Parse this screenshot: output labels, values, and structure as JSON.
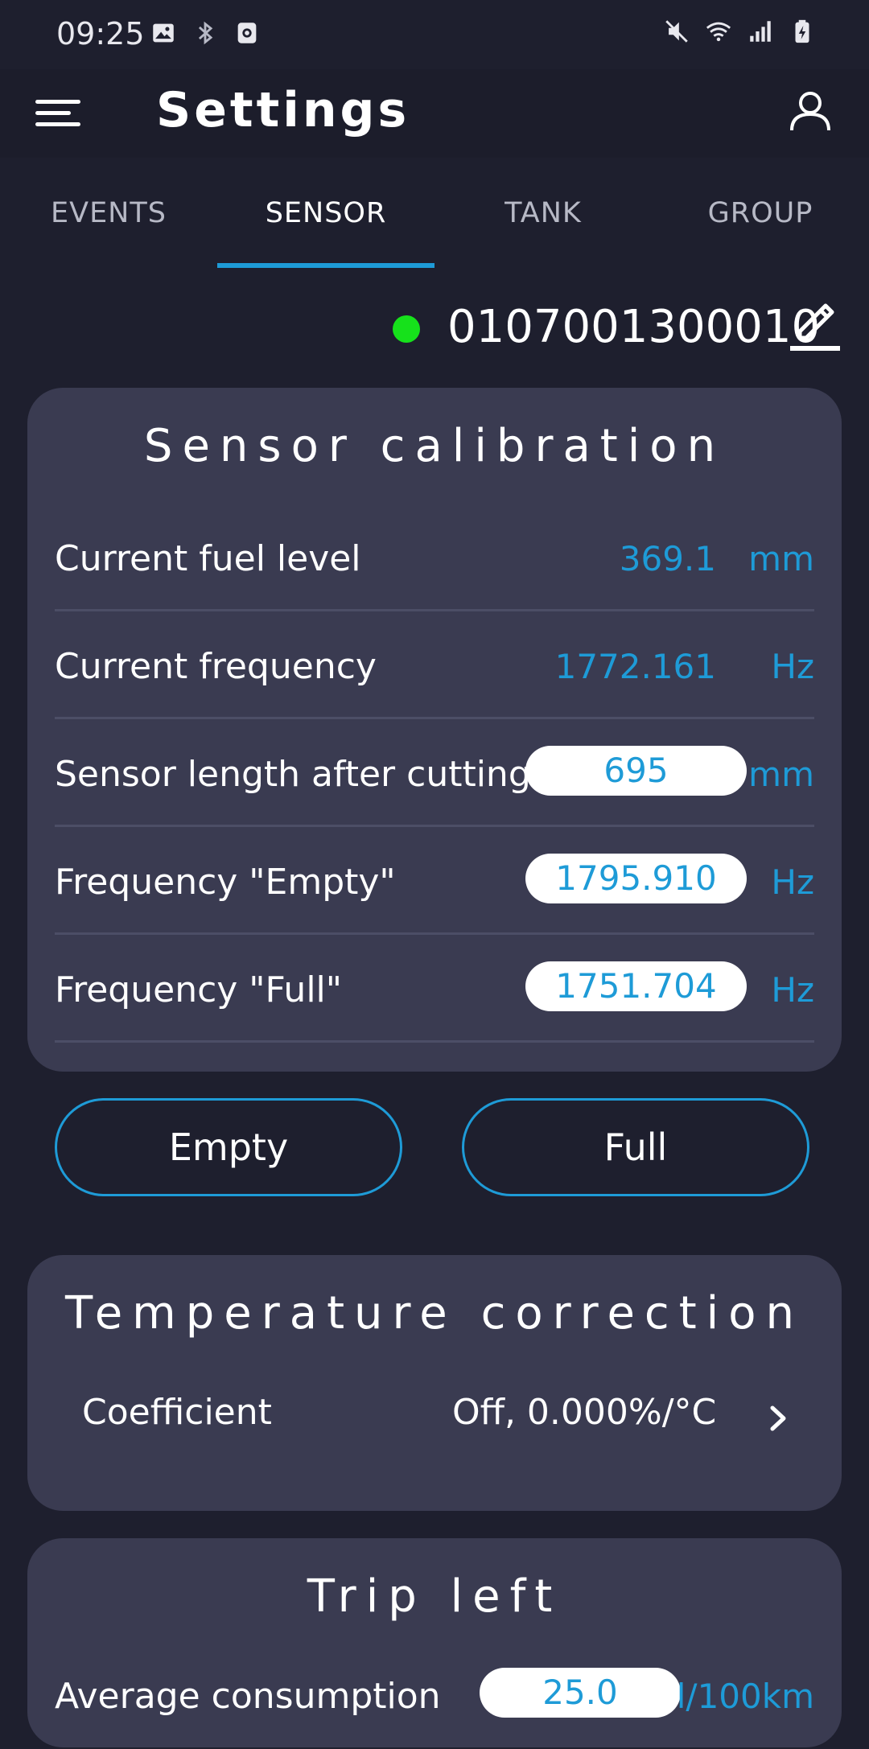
{
  "status_bar": {
    "time": "09:25",
    "left_icons": [
      "image-icon",
      "bluetooth-icon",
      "camera-icon"
    ],
    "right_icons": [
      "mute-icon",
      "wifi-icon",
      "signal-icon",
      "battery-charging-icon"
    ]
  },
  "app_bar": {
    "title": "Settings"
  },
  "tabs": [
    {
      "label": "EVENTS",
      "active": false
    },
    {
      "label": "SENSOR",
      "active": true
    },
    {
      "label": "TANK",
      "active": false
    },
    {
      "label": "GROUP",
      "active": false
    }
  ],
  "device": {
    "id": "0107001300010",
    "status_color": "#16e11b"
  },
  "sensor_calibration": {
    "title": "Sensor calibration",
    "rows": [
      {
        "label": "Current fuel level",
        "value": "369.1",
        "unit": "mm"
      },
      {
        "label": "Current frequency",
        "value": "1772.161",
        "unit": "Hz"
      },
      {
        "label": "Sensor length after cutting",
        "value": "695",
        "unit": "mm"
      },
      {
        "label": "Frequency \"Empty\"",
        "value": "1795.910",
        "unit": "Hz"
      },
      {
        "label": "Frequency \"Full\"",
        "value": "1751.704",
        "unit": "Hz"
      }
    ]
  },
  "buttons": {
    "empty_label": "Empty",
    "full_label": "Full"
  },
  "temperature_correction": {
    "title": "Temperature correction",
    "coefficient_label": "Coefficient",
    "coefficient_value": "Off, 0.000%/°C"
  },
  "trip_left": {
    "title": "Trip left",
    "avg_label": "Average consumption",
    "avg_value": "25.0",
    "avg_unit": "l/100km"
  },
  "colors": {
    "accent": "#1e9bd7",
    "background": "#1e1f2e",
    "card": "#3a3b51"
  }
}
